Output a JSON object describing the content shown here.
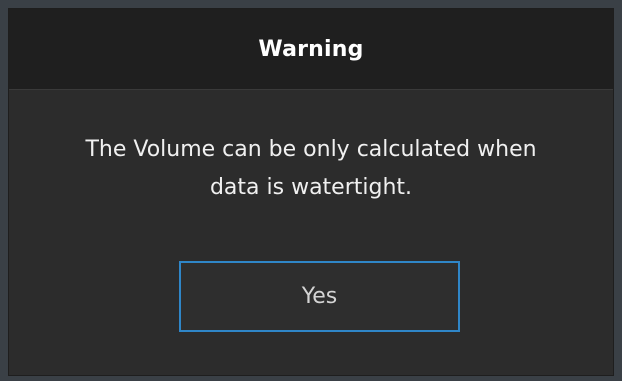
{
  "dialog": {
    "title": "Warning",
    "message": "The Volume can be only calculated when\ndata is watertight.",
    "buttons": {
      "yes_label": "Yes"
    }
  },
  "colors": {
    "background": "#2c2c2c",
    "titlebar": "#1f1f1f",
    "accent_border": "#2f86c8",
    "text": "#ffffff"
  }
}
